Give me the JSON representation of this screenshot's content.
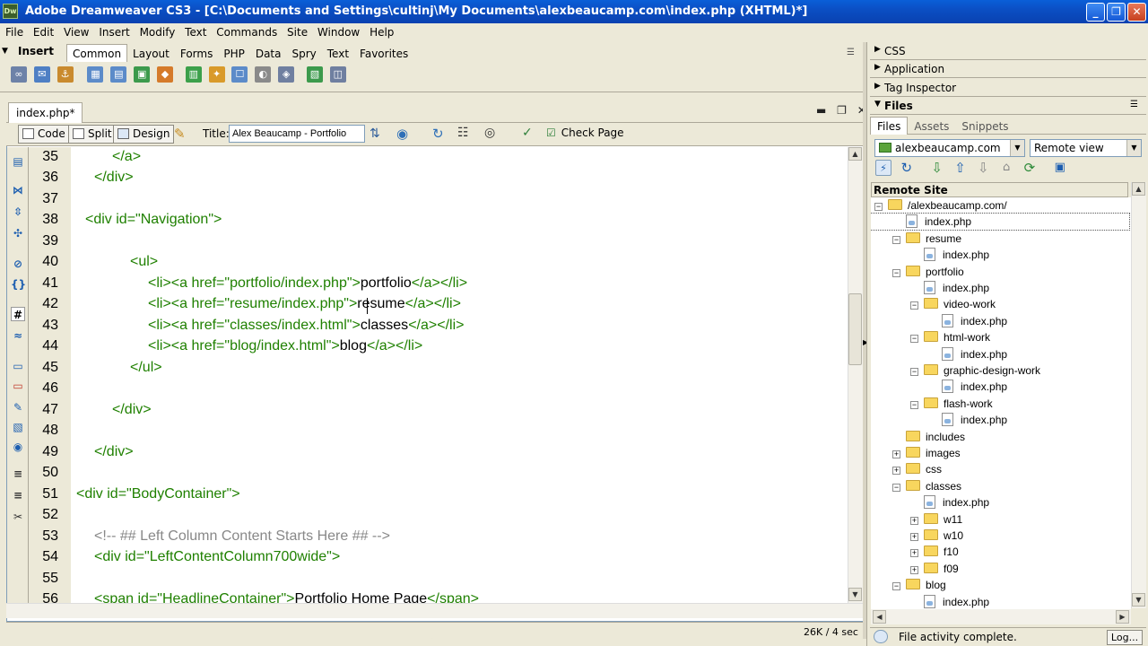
{
  "window": {
    "app_logo": "Dw",
    "title": "Adobe Dreamweaver CS3 - [C:\\Documents and Settings\\cultinj\\My Documents\\alexbeaucamp.com\\index.php (XHTML)*]"
  },
  "menu": [
    "File",
    "Edit",
    "View",
    "Insert",
    "Modify",
    "Text",
    "Commands",
    "Site",
    "Window",
    "Help"
  ],
  "insert_panel": {
    "label": "Insert",
    "tabs": [
      "Common",
      "Layout",
      "Forms",
      "PHP",
      "Data",
      "Spry",
      "Text",
      "Favorites"
    ],
    "active_tab": "Common"
  },
  "document": {
    "tab_label": "index.php*",
    "views": {
      "code": "Code",
      "split": "Split",
      "design": "Design"
    },
    "title_label": "Title:",
    "title_value": "Alex Beaucamp - Portfolio",
    "check_page": "Check Page"
  },
  "code": {
    "line_numbers": [
      "35",
      "36",
      "37",
      "38",
      "39",
      "40",
      "41",
      "42",
      "43",
      "44",
      "45",
      "46",
      "47",
      "48",
      "49",
      "50",
      "51",
      "52",
      "53",
      "54",
      "55",
      "56"
    ],
    "lines": {
      "l35": "</a>",
      "l36": "</div>",
      "l38_open": "<div id=\"Navigation\">",
      "l40": "<ul>",
      "l41_tag": "<li><a href=\"portfolio/index.php\">",
      "l41_text": "portfolio",
      "l41_close": "</a></li>",
      "l42_tag": "<li><a href=\"resume/index.php\">",
      "l42_text": "resume",
      "l42_close": "</a></li>",
      "l43_tag": "<li><a href=\"classes/index.html\">",
      "l43_text": "classes",
      "l43_close": "</a></li>",
      "l44_tag": "<li><a href=\"blog/index.html\">",
      "l44_text": "blog",
      "l44_close": "</a></li>",
      "l45": "</ul>",
      "l47": "</div>",
      "l49": "</div>",
      "l51": "<div id=\"BodyContainer\">",
      "l53": "<!-- ## Left Column Content Starts Here ## -->",
      "l54": "<div id=\"LeftContentColumn700wide\">",
      "l56_tag": "<span id=\"HeadlineContainer\">",
      "l56_text": "Portfolio Home Page",
      "l56_close": "</span>"
    }
  },
  "status": {
    "size_time": "26K / 4 sec"
  },
  "dock": {
    "panels": [
      "CSS",
      "Application",
      "Tag Inspector",
      "Files"
    ],
    "files_tabs": [
      "Files",
      "Assets",
      "Snippets"
    ],
    "site_select": "alexbeaucamp.com",
    "view_select": "Remote view",
    "tree_header": "Remote Site",
    "tree": [
      {
        "label": "/alexbeaucamp.com/",
        "kind": "folder",
        "level": 0,
        "expander": "−"
      },
      {
        "label": "index.php",
        "kind": "file",
        "level": 1,
        "expander": ""
      },
      {
        "label": "resume",
        "kind": "folder",
        "level": 1,
        "expander": "−"
      },
      {
        "label": "index.php",
        "kind": "file",
        "level": 2,
        "expander": ""
      },
      {
        "label": "portfolio",
        "kind": "folder",
        "level": 1,
        "expander": "−"
      },
      {
        "label": "index.php",
        "kind": "file",
        "level": 2,
        "expander": ""
      },
      {
        "label": "video-work",
        "kind": "folder",
        "level": 2,
        "expander": "−"
      },
      {
        "label": "index.php",
        "kind": "file",
        "level": 3,
        "expander": ""
      },
      {
        "label": "html-work",
        "kind": "folder",
        "level": 2,
        "expander": "−"
      },
      {
        "label": "index.php",
        "kind": "file",
        "level": 3,
        "expander": ""
      },
      {
        "label": "graphic-design-work",
        "kind": "folder",
        "level": 2,
        "expander": "−"
      },
      {
        "label": "index.php",
        "kind": "file",
        "level": 3,
        "expander": ""
      },
      {
        "label": "flash-work",
        "kind": "folder",
        "level": 2,
        "expander": "−"
      },
      {
        "label": "index.php",
        "kind": "file",
        "level": 3,
        "expander": ""
      },
      {
        "label": "includes",
        "kind": "folder",
        "level": 1,
        "expander": ""
      },
      {
        "label": "images",
        "kind": "folder",
        "level": 1,
        "expander": "+"
      },
      {
        "label": "css",
        "kind": "folder",
        "level": 1,
        "expander": "+"
      },
      {
        "label": "classes",
        "kind": "folder",
        "level": 1,
        "expander": "−"
      },
      {
        "label": "index.php",
        "kind": "file",
        "level": 2,
        "expander": ""
      },
      {
        "label": "w11",
        "kind": "folder",
        "level": 2,
        "expander": "+"
      },
      {
        "label": "w10",
        "kind": "folder",
        "level": 2,
        "expander": "+"
      },
      {
        "label": "f10",
        "kind": "folder",
        "level": 2,
        "expander": "+"
      },
      {
        "label": "f09",
        "kind": "folder",
        "level": 2,
        "expander": "+"
      },
      {
        "label": "blog",
        "kind": "folder",
        "level": 1,
        "expander": "−"
      },
      {
        "label": "index.php",
        "kind": "file",
        "level": 2,
        "expander": ""
      }
    ],
    "status_text": "File activity complete.",
    "log_button": "Log..."
  }
}
